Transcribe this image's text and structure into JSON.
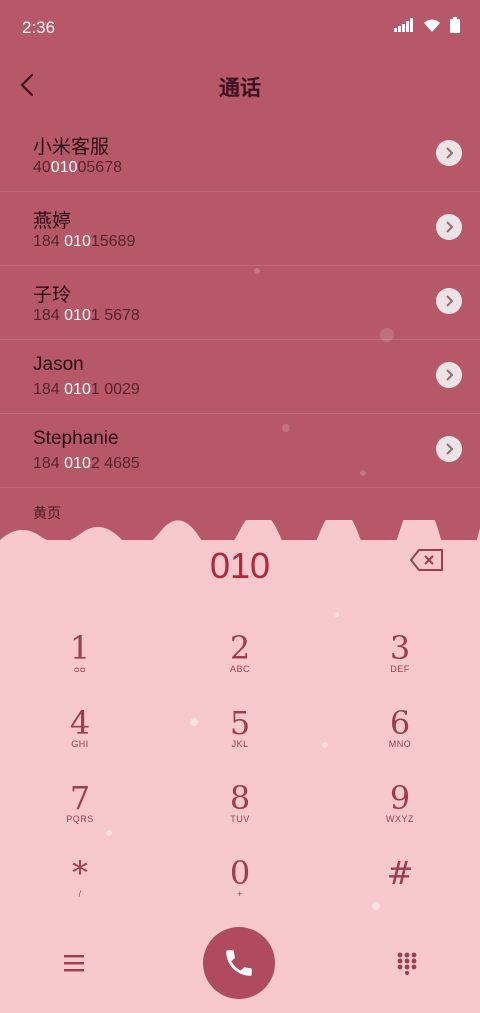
{
  "status": {
    "time": "2:36"
  },
  "header": {
    "title": "通话"
  },
  "contacts": [
    {
      "name": "小米客服",
      "pre": "40",
      "hl": "010",
      "post": "05678"
    },
    {
      "name": "燕婷",
      "pre": "184 ",
      "hl": "010",
      "post": "15689"
    },
    {
      "name": "子玲",
      "pre": "184 ",
      "hl": "010",
      "post": "1 5678"
    },
    {
      "name": "Jason",
      "pre": "184 ",
      "hl": "010",
      "post": "1 0029"
    },
    {
      "name": "Stephanie",
      "pre": "184 ",
      "hl": "010",
      "post": "2 4685"
    }
  ],
  "section_label": "黄页",
  "dialed": "010",
  "keys": [
    {
      "d": "1",
      "l": "ᴑᴑ"
    },
    {
      "d": "2",
      "l": "ABC"
    },
    {
      "d": "3",
      "l": "DEF"
    },
    {
      "d": "4",
      "l": "GHI"
    },
    {
      "d": "5",
      "l": "JKL"
    },
    {
      "d": "6",
      "l": "MNO"
    },
    {
      "d": "7",
      "l": "PQRS"
    },
    {
      "d": "8",
      "l": "TUV"
    },
    {
      "d": "9",
      "l": "WXYZ"
    },
    {
      "d": "*",
      "l": "/"
    },
    {
      "d": "0",
      "l": "+"
    },
    {
      "d": "#",
      "l": ""
    }
  ],
  "colors": {
    "top_bg": "#b65867",
    "pad_bg": "#f7c9cc",
    "accent": "#b0283a",
    "call_bg": "#b04a5e"
  },
  "icons": {
    "back": "chevron-left-icon",
    "delete": "backspace-icon",
    "call": "phone-icon",
    "menu": "menu-icon",
    "keypad": "dialpad-icon"
  }
}
